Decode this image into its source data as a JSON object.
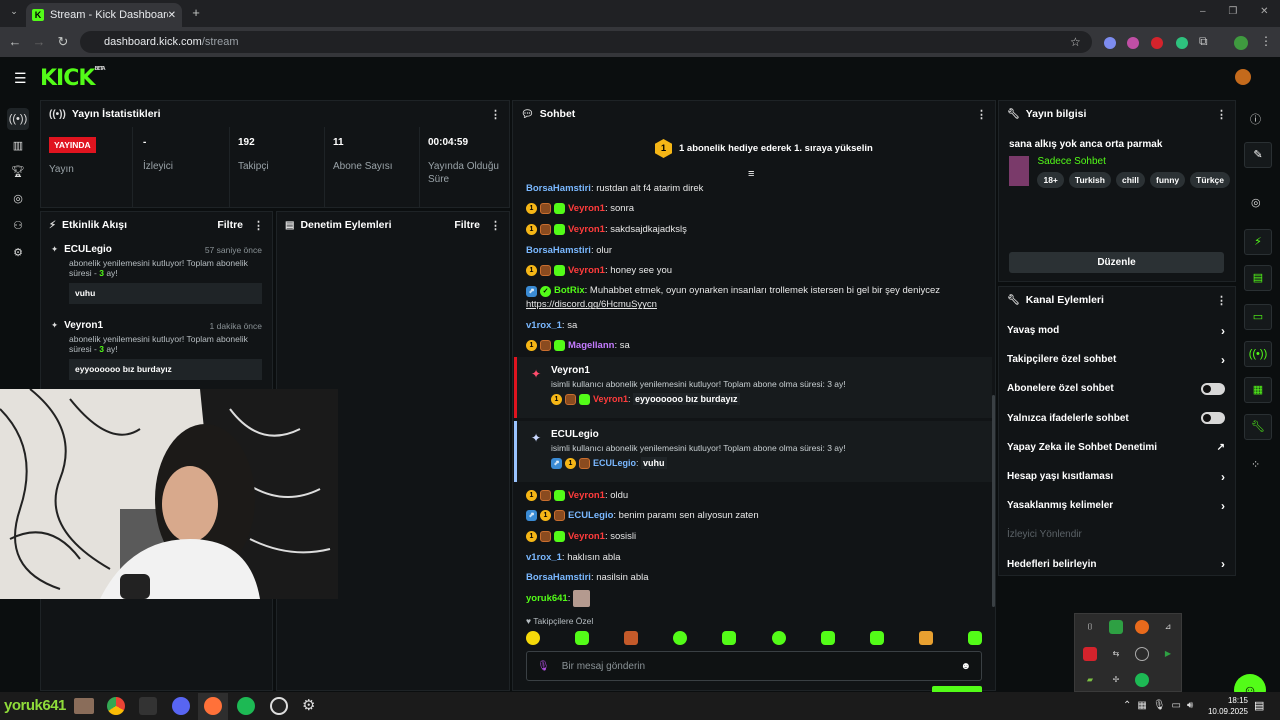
{
  "browser": {
    "tab_title": "Stream - Kick Dashboard",
    "url_host": "dashboard.kick.com",
    "url_path": "/stream"
  },
  "logo": {
    "text": "KICK",
    "badge": "BETA"
  },
  "stats": {
    "title": "Yayın İstatistikleri",
    "live_badge": "YAYINDA",
    "items": [
      {
        "value": "",
        "label": "Yayın"
      },
      {
        "value": "-",
        "label": "İzleyici"
      },
      {
        "value": "192",
        "label": "Takipçi"
      },
      {
        "value": "11",
        "label": "Abone Sayısı"
      },
      {
        "value": "00:04:59",
        "label": "Yayında Olduğu Süre"
      }
    ]
  },
  "activity": {
    "title": "Etkinlik Akışı",
    "filter": "Filtre",
    "events": [
      {
        "name": "ECULegio",
        "time": "57 saniye önce",
        "desc": "abonelik yenilemesini kutluyor! Toplam abonelik süresi - ",
        "months": "3",
        "suffix": " ay!",
        "message": "vuhu"
      },
      {
        "name": "Veyron1",
        "time": "1 dakika önce",
        "desc": "abonelik yenilemesini kutluyor! Toplam abonelik süresi - ",
        "months": "3",
        "suffix": " ay!",
        "message": "eyyoooooo bız burdayız"
      }
    ]
  },
  "moderation": {
    "title": "Denetim Eylemleri",
    "filter": "Filtre"
  },
  "chat": {
    "title": "Sohbet",
    "pinned": "1 abonelik hediye ederek 1. sıraya yükselin",
    "pinned_badge": "1",
    "messages": [
      {
        "user": "BorsaHamstiri",
        "text": ": rustdan alt f4 atarim direk"
      },
      {
        "user": "Veyron1",
        "text": ": sonra"
      },
      {
        "user": "Veyron1",
        "text": ": sakdsajdkajadkslş"
      },
      {
        "user": "BorsaHamstiri",
        "text": ": olur"
      },
      {
        "user": "Veyron1",
        "text": ": honey see you"
      },
      {
        "user": "BotRix",
        "text": ": Muhabbet etmek, oyun oynarken insanları trollemek istersen bi gel bir şey deniycez",
        "link": "https://discord.gg/6HcmuSyycn"
      },
      {
        "user": "v1rox_1",
        "text": ": sa"
      },
      {
        "user": "Magellann",
        "text": ": sa"
      },
      {
        "user": "Veyron1",
        "text": ": oldu"
      },
      {
        "user": "ECULegio",
        "text": ": benim paramı sen alıyosun zaten"
      },
      {
        "user": "Veyron1",
        "text": ": sosisli"
      },
      {
        "user": "v1rox_1",
        "text": ": haklısın abla"
      },
      {
        "user": "BorsaHamstiri",
        "text": ": nasilsin abla"
      },
      {
        "user": "yoruk641",
        "text": ":"
      }
    ],
    "sub_events": [
      {
        "name": "Veyron1",
        "desc": "isimli kullanıcı abonelik yenilemesini kutluyor! Toplam abone olma süresi: 3 ay!",
        "user": "Veyron1",
        "message": "eyyoooooo bız burdayız"
      },
      {
        "name": "ECULegio",
        "desc": "isimli kullanıcı abonelik yenilemesini kutluyor! Toplam abone olma süresi: 3 ay!",
        "user": "ECULegio",
        "message": "vuhu"
      }
    ],
    "followers_only": "Takipçilere Özel",
    "input_placeholder": "Bir mesaj gönderin"
  },
  "stream_info": {
    "title": "Yayın bilgisi",
    "stream_title": "sana alkış yok anca orta parmak",
    "category": "Sadece Sohbet",
    "tags": [
      "18+",
      "Turkish",
      "chill",
      "funny",
      "Türkçe"
    ],
    "edit_button": "Düzenle"
  },
  "channel_actions": {
    "title": "Kanal Eylemleri",
    "items": [
      {
        "label": "Yavaş mod",
        "control": "chevron"
      },
      {
        "label": "Takipçilere özel sohbet",
        "control": "chevron"
      },
      {
        "label": "Abonelere özel sohbet",
        "control": "toggle"
      },
      {
        "label": "Yalnızca ifadelerle sohbet",
        "control": "toggle"
      },
      {
        "label": "Yapay Zeka ile Sohbet Denetimi",
        "control": "external"
      },
      {
        "label": "Hesap yaşı kısıtlaması",
        "control": "chevron"
      },
      {
        "label": "Yasaklanmış kelimeler",
        "control": "chevron"
      },
      {
        "label": "İzleyici Yönlendir",
        "control": "disabled"
      },
      {
        "label": "Hedefleri belirleyin",
        "control": "chevron"
      }
    ]
  },
  "taskbar": {
    "watermark": "yoruk641",
    "time": "18:15",
    "date": "10.09.2025"
  },
  "colors": {
    "kick_green": "#53fc18",
    "live_red": "#e0141f",
    "panel_bg": "#111416"
  }
}
